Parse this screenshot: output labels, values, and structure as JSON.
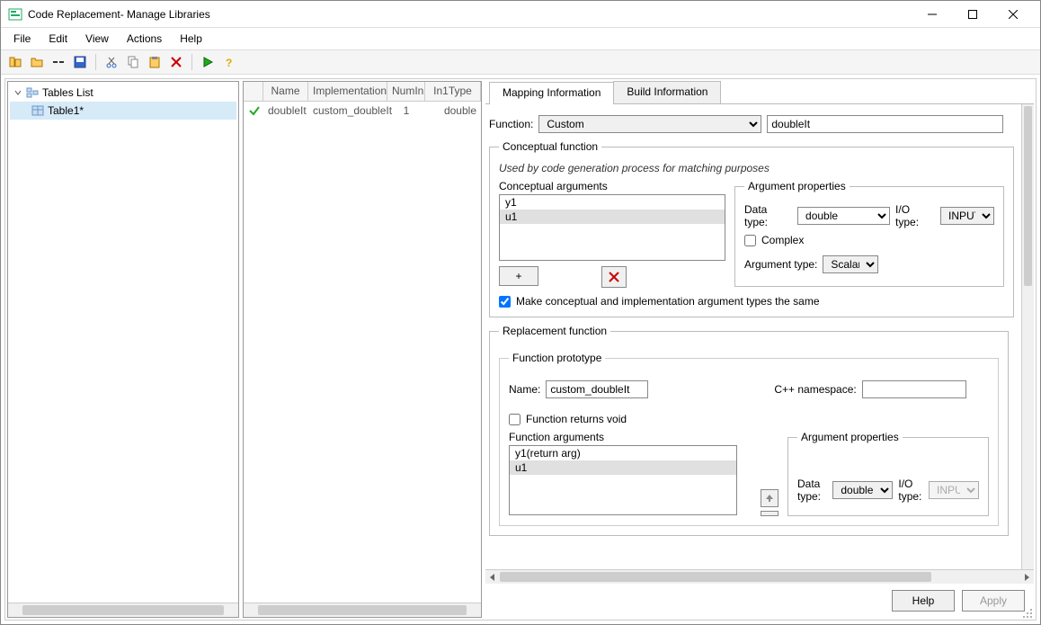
{
  "title": "Code Replacement- Manage Libraries",
  "menu": {
    "file": "File",
    "edit": "Edit",
    "view": "View",
    "actions": "Actions",
    "help": "Help"
  },
  "toolbar_icons": {
    "new": "new",
    "open": "open",
    "remove": "remove",
    "save": "save",
    "cut": "cut",
    "copy": "copy",
    "paste": "paste",
    "delete": "delete",
    "run": "run",
    "help": "help"
  },
  "tree": {
    "root_label": "Tables List",
    "items": [
      {
        "label": "Table1*"
      }
    ]
  },
  "table": {
    "columns": {
      "name": "Name",
      "impl": "Implementation",
      "numin": "NumIn",
      "in1type": "In1Type"
    },
    "rows": [
      {
        "checked": true,
        "name": "doubleIt",
        "impl": "custom_doubleIt",
        "numin": "1",
        "in1type": "double"
      }
    ]
  },
  "tabs": {
    "mapping": "Mapping Information",
    "build": "Build Information"
  },
  "function_row": {
    "label": "Function:",
    "select_value": "Custom",
    "name_value": "doubleIt"
  },
  "conceptual": {
    "legend": "Conceptual function",
    "note": "Used by code generation process for matching purposes",
    "args_label": "Conceptual arguments",
    "args": [
      "y1",
      "u1"
    ],
    "add_btn": "+",
    "checkbox_label": "Make conceptual and implementation argument types the same"
  },
  "arg_props": {
    "legend": "Argument properties",
    "datatype_label": "Data type:",
    "datatype_value": "double",
    "iotype_label": "I/O type:",
    "iotype_value": "INPUT",
    "complex_label": "Complex",
    "argtype_label": "Argument type:",
    "argtype_value": "Scalar"
  },
  "replacement": {
    "legend": "Replacement function",
    "proto_legend": "Function prototype",
    "name_label": "Name:",
    "name_value": "custom_doubleIt",
    "ns_label": "C++ namespace:",
    "ns_value": "",
    "returns_void_label": "Function returns void",
    "funcargs_label": "Function arguments",
    "funcargs": [
      "y1(return arg)",
      "u1"
    ],
    "arg_props2": {
      "legend": "Argument properties",
      "datatype_label": "Data type:",
      "datatype_value": "double",
      "iotype_label": "I/O type:",
      "iotype_value": "INPUT"
    }
  },
  "buttons": {
    "help": "Help",
    "apply": "Apply"
  }
}
